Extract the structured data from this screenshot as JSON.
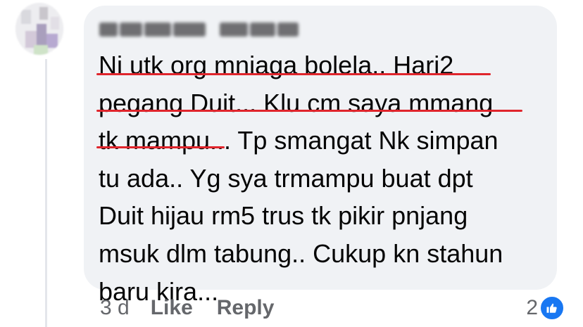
{
  "comment": {
    "lines": [
      "Ni utk org mniaga bolela.. Hari2",
      "pegang Duit... Klu cm saya mmang",
      "tk mampu... Tp smangat Nk simpan",
      "tu ada.. Yg sya trmampu buat dpt",
      "Duit hijau rm5 trus tk pikir pnjang",
      "msuk dlm tabung.. Cukup kn stahun",
      "baru kira..."
    ]
  },
  "meta": {
    "time": "3 d",
    "like_label": "Like",
    "reply_label": "Reply"
  },
  "reactions": {
    "count": "2",
    "icon": "thumbs-up-icon"
  },
  "colors": {
    "bubble": "#f0f2f5",
    "text": "#050505",
    "meta": "#65676b",
    "underline": "#e0252c",
    "like_blue": "#1877f2"
  }
}
